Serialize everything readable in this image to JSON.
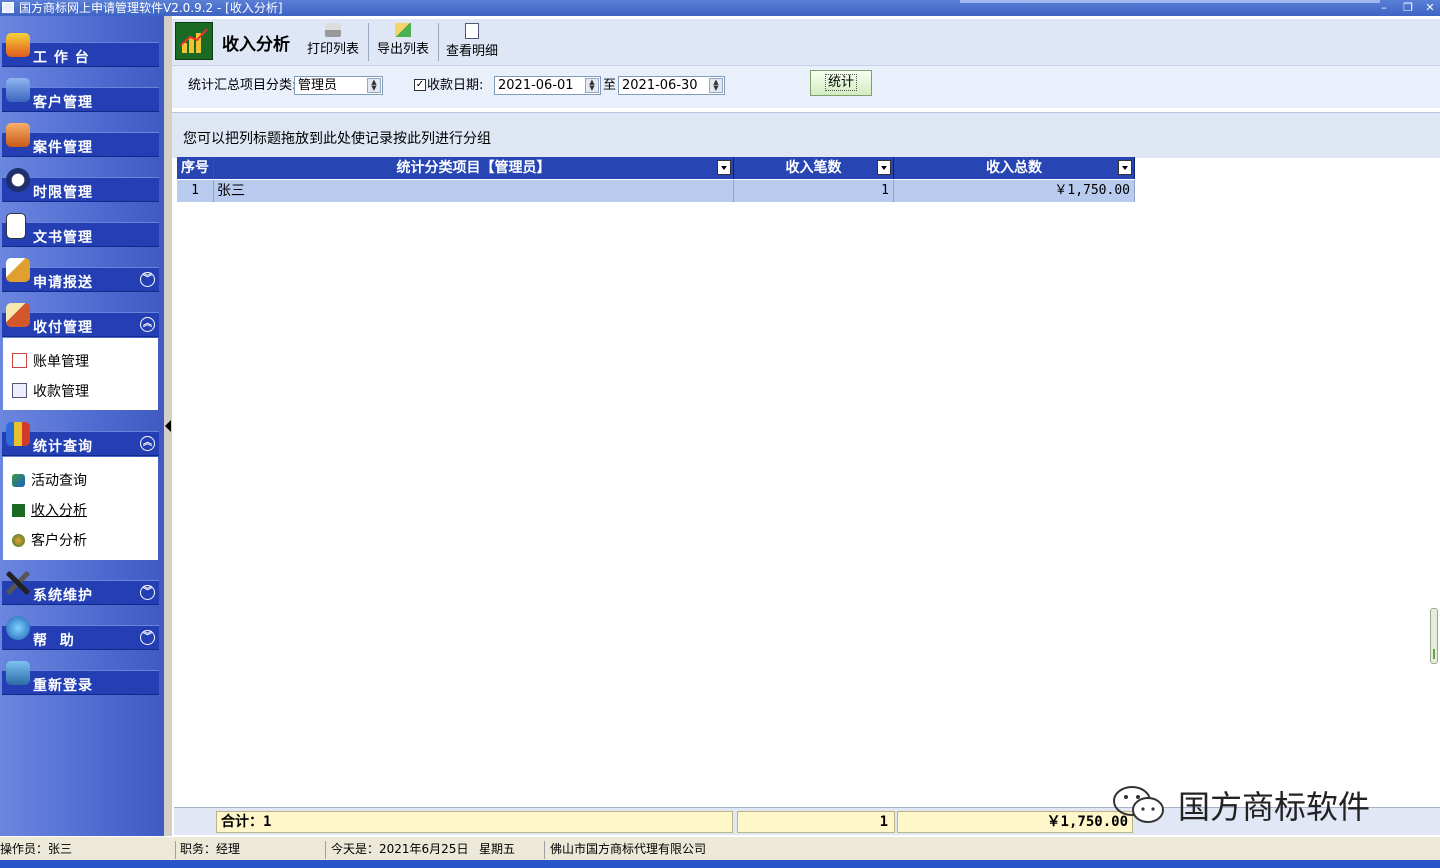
{
  "window": {
    "title": "国方商标网上申请管理软件V2.0.9.2 - [收入分析]",
    "minimize": "–",
    "restore": "❐",
    "close": "✕"
  },
  "sidebar": {
    "sections": [
      {
        "label": "工 作 台"
      },
      {
        "label": "客户管理"
      },
      {
        "label": "案件管理"
      },
      {
        "label": "时限管理"
      },
      {
        "label": "文书管理"
      },
      {
        "label": "申请报送",
        "chevron": "︾"
      },
      {
        "label": "收付管理",
        "chevron": "︽",
        "items": [
          "账单管理",
          "收款管理"
        ]
      },
      {
        "label": "统计查询",
        "chevron": "︽",
        "items": [
          "活动查询",
          "收入分析",
          "客户分析"
        ]
      },
      {
        "label": "系统维护",
        "chevron": "︾"
      },
      {
        "label": "帮  助",
        "chevron": "︾"
      },
      {
        "label": "重新登录"
      }
    ]
  },
  "toolbar": {
    "title": "收入分析",
    "print_label": "打印列表",
    "export_label": "导出列表",
    "detail_label": "查看明细"
  },
  "filter": {
    "category_label": "统计汇总项目分类:",
    "category_value": "管理员",
    "date_checked": "✓",
    "date_label": "收款日期:",
    "date_from": "2021-06-01",
    "date_to_label": "至",
    "date_to": "2021-06-30",
    "stat_button": "统计"
  },
  "group_hint": "您可以把列标题拖放到此处使记录按此列进行分组",
  "grid": {
    "columns": [
      "序号",
      "统计分类项目【管理员】",
      "收入笔数",
      "收入总数"
    ],
    "rows": [
      {
        "no": "1",
        "name": "张三",
        "count": "1",
        "total": "￥1,750.00"
      }
    ],
    "footer": {
      "label": "合计：1",
      "count": "1",
      "total": "￥1,750.00"
    }
  },
  "watermark": "国方商标软件",
  "statusbar": {
    "operator": "操作员：张三",
    "position": "职务：经理",
    "today": "今天是：2021年6月25日",
    "weekday": "星期五",
    "company": "佛山市国方商标代理有限公司"
  }
}
